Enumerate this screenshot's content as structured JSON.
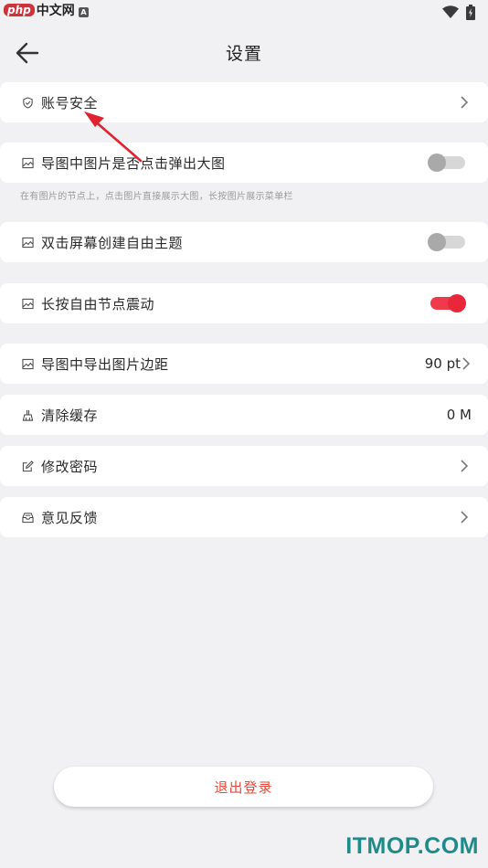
{
  "status_bar": {
    "logo_text": "php",
    "logo_cn": "中文网",
    "notification_badge": "A",
    "icons": [
      "wifi-icon",
      "battery-charging-icon"
    ]
  },
  "header": {
    "back_icon": "arrow-left-icon",
    "title": "设置"
  },
  "settings": {
    "account_security": {
      "label": "账号安全",
      "icon": "shield-check-icon"
    },
    "popup_image": {
      "label": "导图中图片是否点击弹出大图",
      "icon": "image-icon",
      "enabled": false,
      "description": "在有图片的节点上，点击图片直接展示大图，长按图片展示菜单栏"
    },
    "double_tap_topic": {
      "label": "双击屏幕创建自由主题",
      "icon": "image-icon",
      "enabled": false
    },
    "long_press_vibrate": {
      "label": "长按自由节点震动",
      "icon": "image-icon",
      "enabled": true
    },
    "export_margin": {
      "label": "导图中导出图片边距",
      "icon": "image-icon",
      "value": "90 pt"
    },
    "clear_cache": {
      "label": "清除缓存",
      "icon": "broom-icon",
      "value": "0 M"
    },
    "change_password": {
      "label": "修改密码",
      "icon": "edit-icon"
    },
    "feedback": {
      "label": "意见反馈",
      "icon": "inbox-icon"
    }
  },
  "logout_label": "退出登录",
  "watermark": "ITMOP.COM",
  "colors": {
    "background": "#f1f1f3",
    "accent": "#e8273a",
    "logout_text": "#e84a3c",
    "annotation_arrow": "#e0242f",
    "watermark": "#1f8a8a"
  }
}
